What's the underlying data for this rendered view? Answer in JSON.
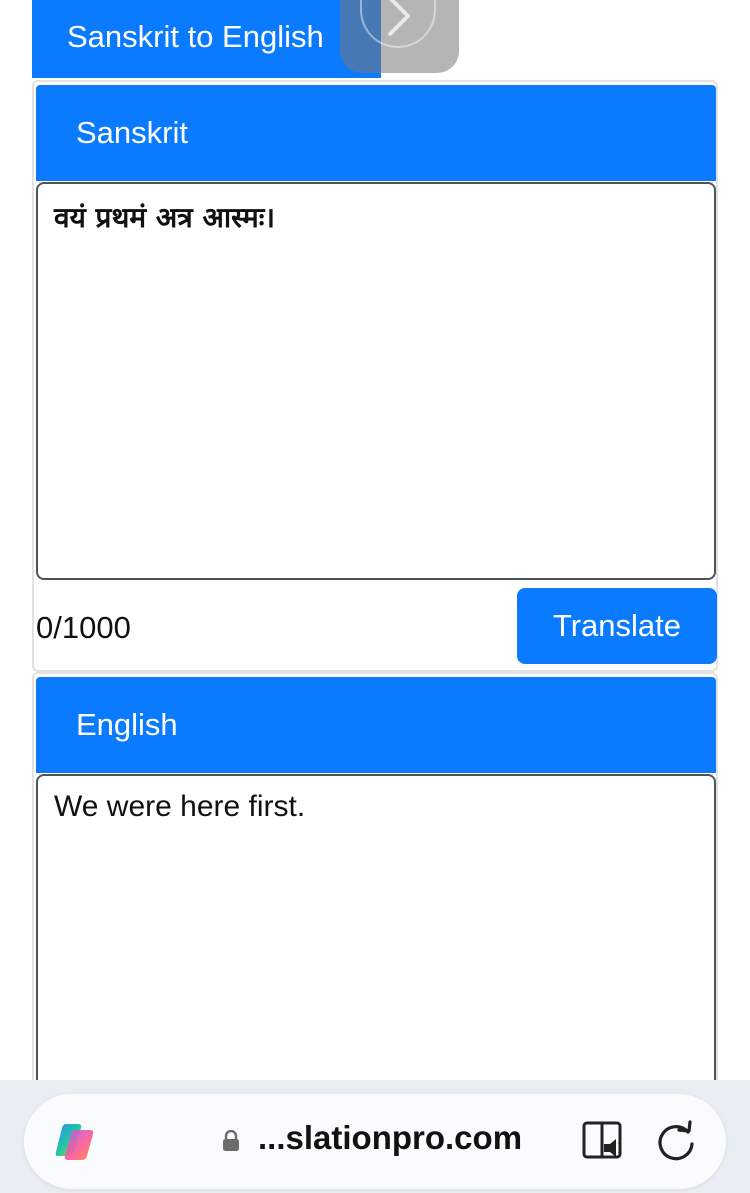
{
  "top_tab": {
    "label": "Sanskrit to English"
  },
  "source": {
    "header": "Sanskrit",
    "text": "वयं प्रथमं अत्र आस्मः।",
    "counter": "0/1000",
    "translate_label": "Translate"
  },
  "target": {
    "header": "English",
    "text": "We were here first."
  },
  "browser": {
    "url": "...slationpro.com"
  },
  "colors": {
    "accent": "#0a7aff",
    "bar_bg": "#e9edf4"
  }
}
